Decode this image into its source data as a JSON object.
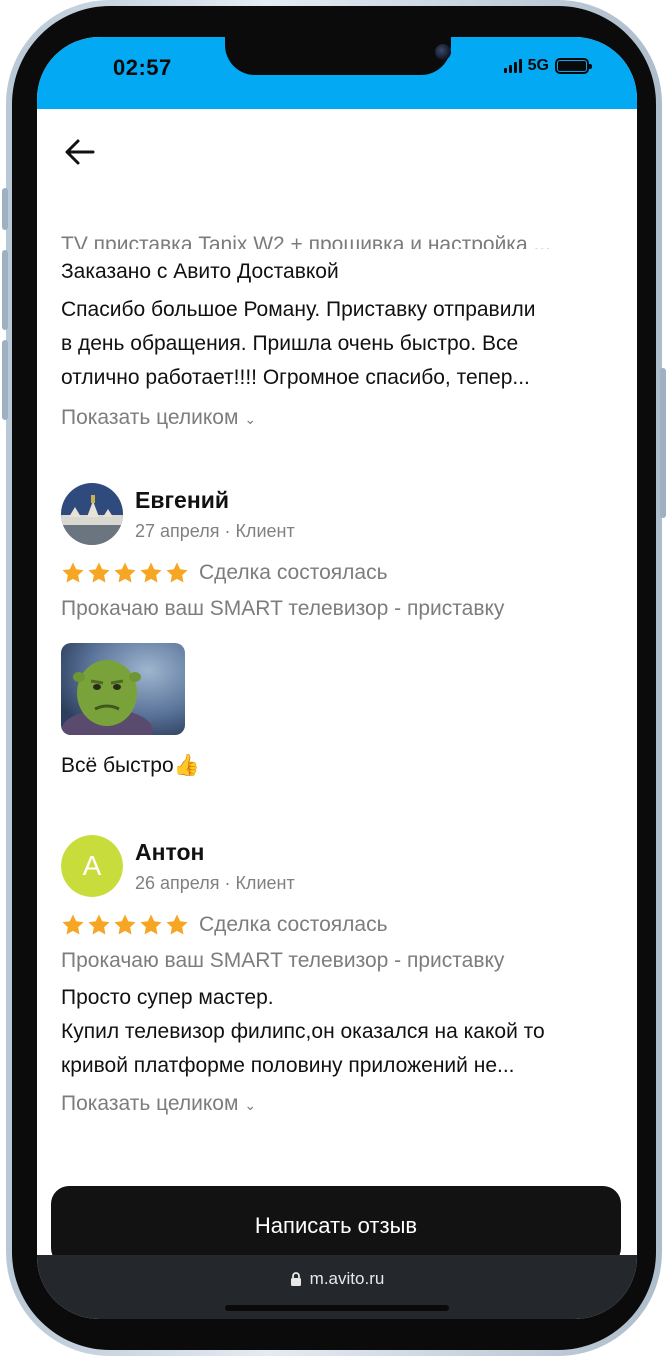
{
  "status": {
    "time": "02:57",
    "network": "5G"
  },
  "header": {
    "truncated_product": "TV приставка Tanix W2 + прошивка и настройка ..."
  },
  "first_review": {
    "delivery": "Заказано с Авито Доставкой",
    "text_lines": [
      "Спасибо большое Роману. Приставку отправили",
      "в день обращения. Пришла очень быстро. Все",
      "отлично работает!!!! Огромное спасибо, тепер..."
    ],
    "show_more": "Показать целиком"
  },
  "reviews": [
    {
      "name": "Евгений",
      "meta": "27 апреля · Клиент",
      "rating": 5,
      "deal": "Сделка состоялась",
      "product": "Прокачаю ваш SMART телевизор - приставку",
      "text": "Всё быстро👍"
    },
    {
      "name": "Антон",
      "avatar_letter": "А",
      "avatar_color": "#c8dd3c",
      "meta": "26 апреля · Клиент",
      "rating": 5,
      "deal": "Сделка состоялась",
      "product": "Прокачаю ваш SMART телевизор - приставку",
      "text_lines": [
        "Просто супер мастер.",
        "Купил телевизор филипс,он оказался на какой то",
        "кривой платформе половину приложений не..."
      ],
      "show_more": "Показать целиком"
    }
  ],
  "actions": {
    "write_review": "Написать отзыв"
  },
  "browser": {
    "url": "m.avito.ru"
  },
  "colors": {
    "accent": "#04a9f4",
    "star": "#f6a623",
    "button": "#121212"
  },
  "icons": [
    "back-arrow-icon",
    "chevron-down-icon",
    "star-icon",
    "lock-icon",
    "signal-icon",
    "battery-icon"
  ]
}
